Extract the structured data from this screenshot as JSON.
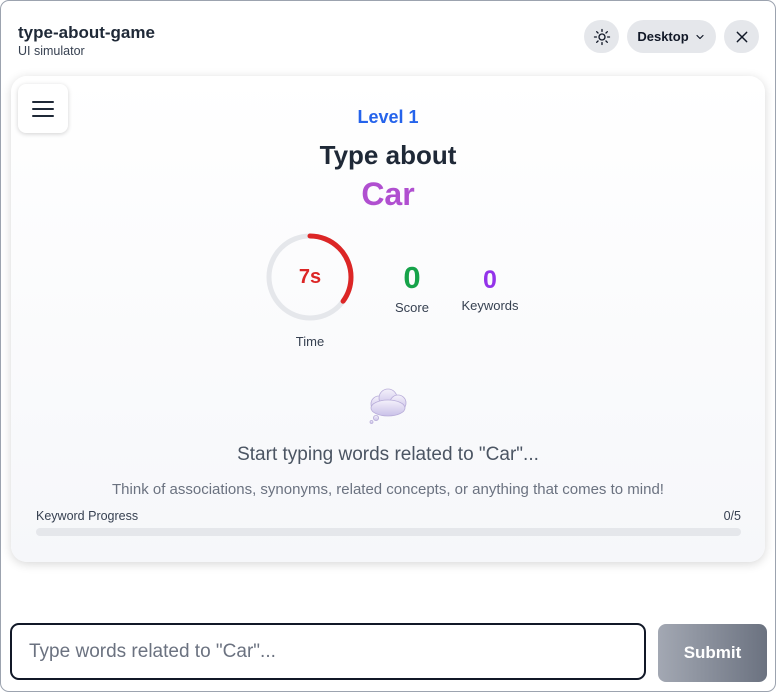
{
  "header": {
    "title": "type-about-game",
    "subtitle": "UI simulator",
    "theme_icon": "sun-icon",
    "device_label": "Desktop",
    "device_icon": "chevron-down-icon",
    "close_icon": "close-icon"
  },
  "game": {
    "menu_icon": "hamburger-menu-icon",
    "level": "Level 1",
    "heading": "Type about",
    "topic": "Car",
    "timer": {
      "value": "7s",
      "label": "Time",
      "remaining_fraction": 0.35
    },
    "score": {
      "value": "0",
      "label": "Score"
    },
    "keywords": {
      "value": "0",
      "label": "Keywords"
    },
    "thought_icon": "thought-bubble-icon",
    "prompt": "Start typing words related to \"Car\"...",
    "hint": "Think of associations, synonyms, related concepts, or anything that comes to mind!",
    "progress": {
      "label": "Keyword Progress",
      "count": "0/5",
      "fraction": 0
    }
  },
  "input": {
    "placeholder": "Type words related to \"Car\"...",
    "value": "",
    "submit_label": "Submit"
  },
  "colors": {
    "level": "#2563eb",
    "topic": "#b04fd0",
    "timer": "#dc2626",
    "score": "#16a34a",
    "keywords": "#9333ea"
  }
}
